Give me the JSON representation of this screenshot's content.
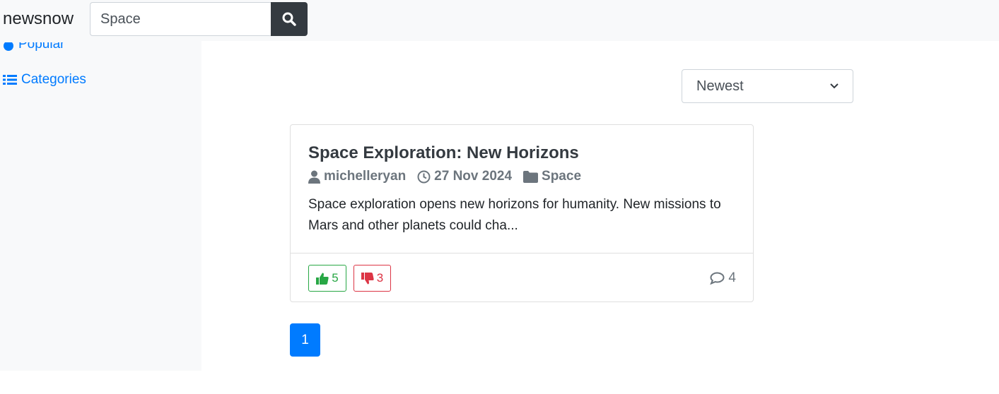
{
  "navbar": {
    "brand": "newsnow",
    "search": {
      "value": "Space",
      "placeholder": ""
    },
    "search_icon": "search-icon"
  },
  "sidebar": {
    "items": [
      {
        "label": "Popular",
        "icon": "fire-icon"
      },
      {
        "label": "Categories",
        "icon": "list-icon"
      }
    ]
  },
  "sort": {
    "selected": "Newest"
  },
  "posts": [
    {
      "title": "Space Exploration: New Horizons",
      "author": "michelleryan",
      "date": "27 Nov 2024",
      "category": "Space",
      "excerpt": "Space exploration opens new horizons for humanity. New missions to Mars and other planets could cha...",
      "likes": "5",
      "dislikes": "3",
      "comments": "4"
    }
  ],
  "pagination": {
    "current": "1"
  },
  "colors": {
    "primary": "#007bff",
    "success": "#28a745",
    "danger": "#dc3545",
    "muted": "#6c757d",
    "dark": "#343a40"
  }
}
